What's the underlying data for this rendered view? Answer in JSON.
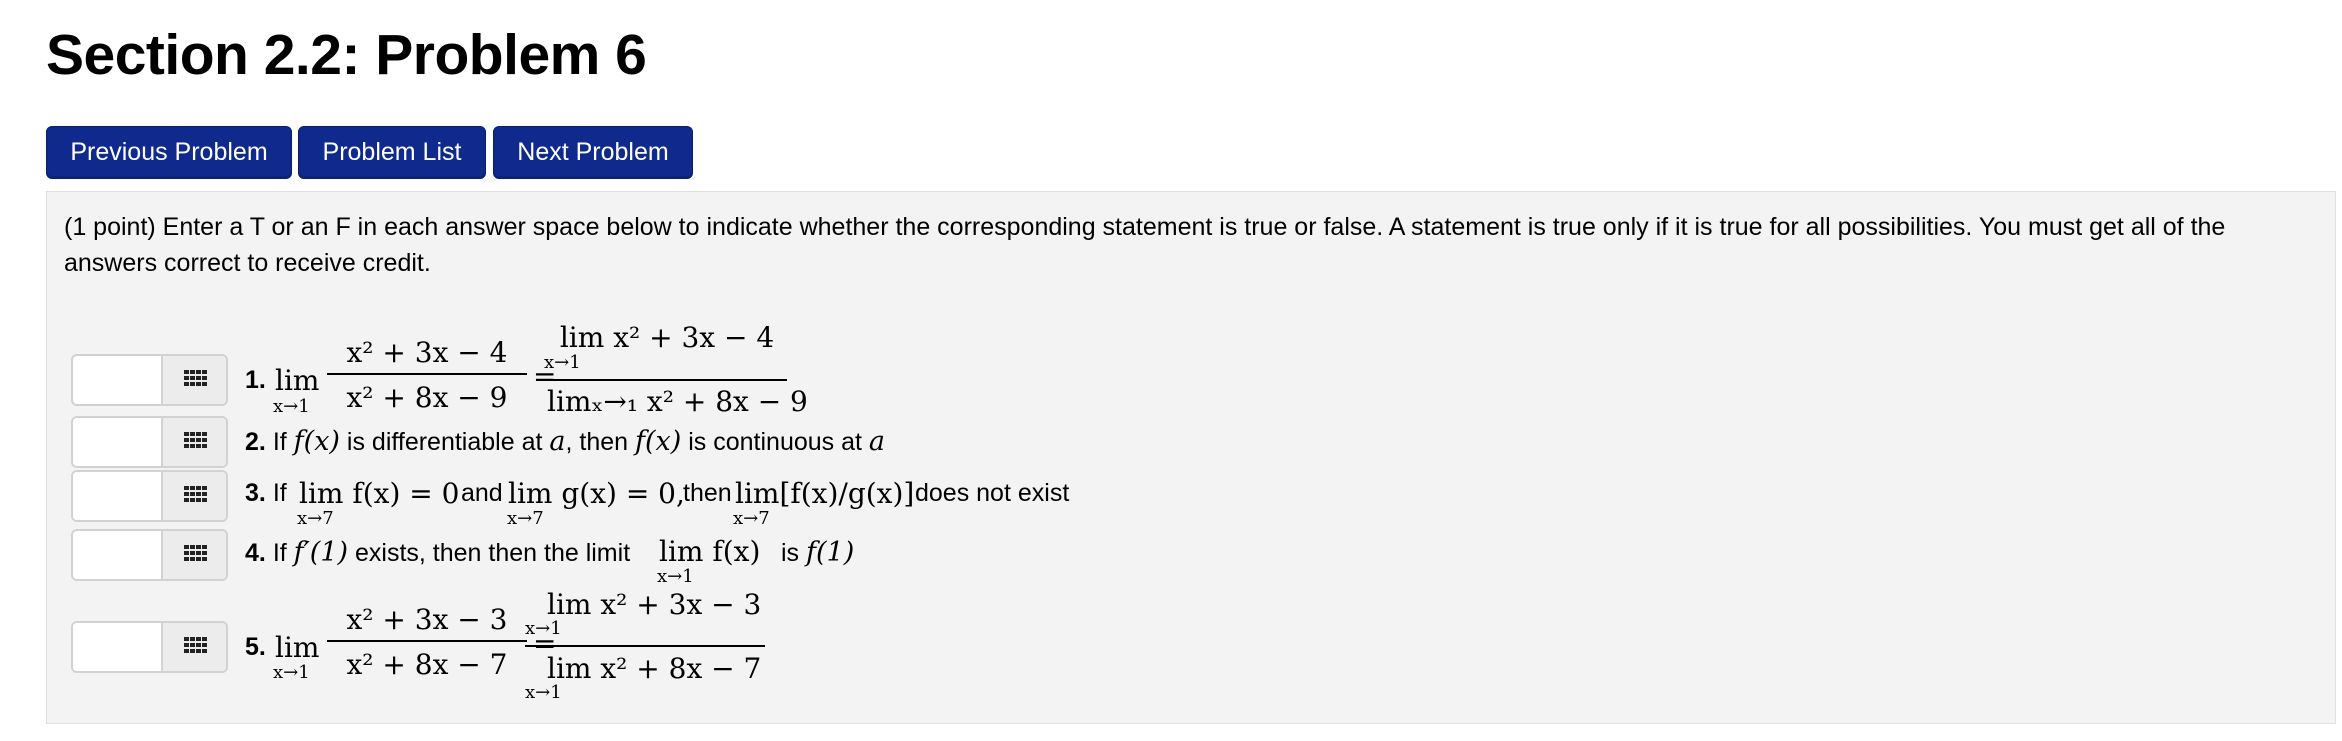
{
  "page": {
    "title": "Section 2.2: Problem 6"
  },
  "nav": {
    "previous_label": "Previous Problem",
    "list_label": "Problem List",
    "next_label": "Next Problem"
  },
  "problem": {
    "intro": "(1 point) Enter a T or an F in each answer space below to indicate whether the corresponding statement is true or false. A statement is true only if it is true for all possibilities. You must get all of the answers correct to receive credit.",
    "answers": [
      "",
      "",
      "",
      "",
      ""
    ],
    "statements": [
      {
        "number": "1.",
        "lim": "lim",
        "under": "x→1",
        "numerator": "x² + 3x − 4",
        "denominator": "x² + 8x − 9",
        "eq": "=",
        "rhs_top_lim": "lim",
        "rhs_top_under": "x→1",
        "rhs_top_expr": "x² + 3x − 4",
        "rhs_bottom": "limₓ→₁ x² + 8x − 9"
      },
      {
        "number": "2.",
        "t1": "If",
        "m1": "f(x)",
        "t2": "is differentiable at",
        "m2": "a",
        "t3": ", then",
        "m3": "f(x)",
        "t4": "is continuous at",
        "m4": "a"
      },
      {
        "number": "3.",
        "t1": "If",
        "lim1": "lim f(x) = 0",
        "under1": "x→7",
        "t2": "and",
        "lim2": "lim g(x) = 0,",
        "under2": "x→7",
        "t3": "then",
        "lim3": "lim[f(x)/g(x)]",
        "under3": "x→7",
        "t4": "does not exist"
      },
      {
        "number": "4.",
        "t1": "If",
        "m1": "f′(1)",
        "t2": "exists, then then the limit",
        "lim": "lim f(x)",
        "under": "x→1",
        "t3": "is",
        "m2": "f(1)"
      },
      {
        "number": "5.",
        "lim": "lim",
        "under": "x→1",
        "numerator": "x² + 3x − 3",
        "denominator": "x² + 8x − 7",
        "eq": "=",
        "rhs_top_lim": "lim",
        "rhs_top_under": "x→1",
        "rhs_top_expr": "x² + 3x − 3",
        "rhs_bottom_lim": "lim",
        "rhs_bottom_under": "x→1",
        "rhs_bottom_expr": "x² + 8x − 7"
      }
    ]
  },
  "icons": {
    "answer_picker": "grid-icon"
  }
}
